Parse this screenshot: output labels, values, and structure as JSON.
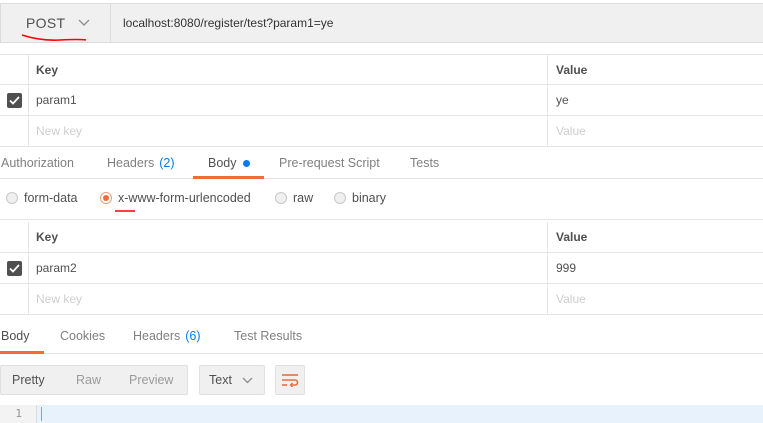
{
  "request": {
    "method": "POST",
    "url": "localhost:8080/register/test?param1=ye"
  },
  "params_table": {
    "key_header": "Key",
    "value_header": "Value",
    "rows": [
      {
        "key": "param1",
        "value": "ye",
        "checked": true
      }
    ],
    "new_key_placeholder": "New key",
    "new_value_placeholder": "Value"
  },
  "request_tabs": [
    {
      "label": "Authorization"
    },
    {
      "label": "Headers",
      "count": "(2)"
    },
    {
      "label": "Body",
      "active": true,
      "has_dot": true
    },
    {
      "label": "Pre-request Script"
    },
    {
      "label": "Tests"
    }
  ],
  "body_types": [
    {
      "label": "form-data",
      "selected": false
    },
    {
      "label": "x-www-form-urlencoded",
      "selected": true
    },
    {
      "label": "raw",
      "selected": false
    },
    {
      "label": "binary",
      "selected": false
    }
  ],
  "body_table": {
    "key_header": "Key",
    "value_header": "Value",
    "rows": [
      {
        "key": "param2",
        "value": "999",
        "checked": true
      }
    ],
    "new_key_placeholder": "New key",
    "new_value_placeholder": "Value"
  },
  "response_tabs": [
    {
      "label": "Body",
      "active": true
    },
    {
      "label": "Cookies"
    },
    {
      "label": "Headers",
      "count": "(6)"
    },
    {
      "label": "Test Results"
    }
  ],
  "response_toolbar": {
    "view_modes": [
      "Pretty",
      "Raw",
      "Preview"
    ],
    "active_view": "Pretty",
    "format": "Text"
  },
  "editor": {
    "line_number": "1"
  },
  "colors": {
    "accent": "#f26b3a",
    "link_blue": "#097bed",
    "annotation_red": "#ff0000"
  }
}
